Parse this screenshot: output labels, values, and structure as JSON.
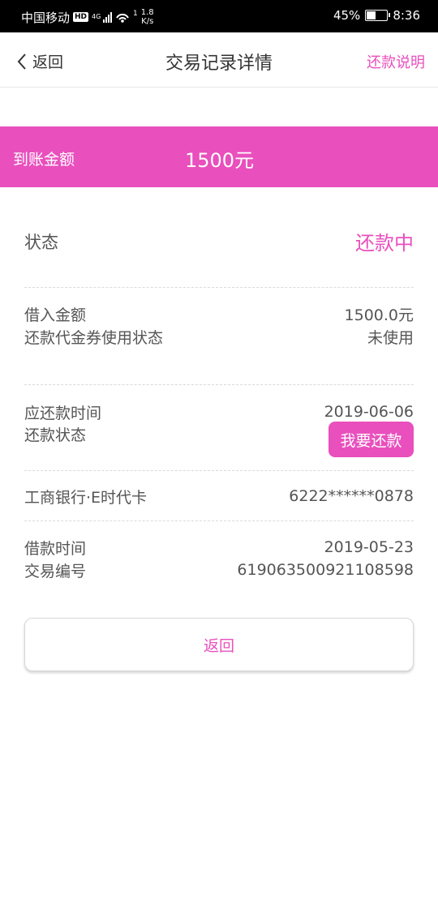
{
  "status_bar": {
    "carrier": "中国移动",
    "hd": "HD",
    "network": "4G",
    "speed_value": "1.8",
    "speed_unit": "K/s",
    "wifi_superscript": "1",
    "battery": "45%",
    "battery_level": 0.45,
    "time": "8:36"
  },
  "header": {
    "back_label": "返回",
    "title": "交易记录详情",
    "help_link": "还款说明"
  },
  "banner": {
    "label": "到账金额",
    "value": "1500元"
  },
  "status": {
    "label": "状态",
    "value": "还款中"
  },
  "loan": {
    "amount_label": "借入金额",
    "amount_value": "1500.0元",
    "voucher_label": "还款代金券使用状态",
    "voucher_value": "未使用"
  },
  "repayment": {
    "due_label": "应还款时间",
    "due_value": "2019-06-06",
    "status_label": "还款状态",
    "repay_button": "我要还款"
  },
  "bank": {
    "name": "工商银行·E时代卡",
    "card_number": "6222******0878"
  },
  "transaction": {
    "time_label": "借款时间",
    "time_value": "2019-05-23",
    "id_label": "交易编号",
    "id_value": "619063500921108598"
  },
  "return_button": "返回",
  "colors": {
    "accent": "#e94fbd"
  }
}
